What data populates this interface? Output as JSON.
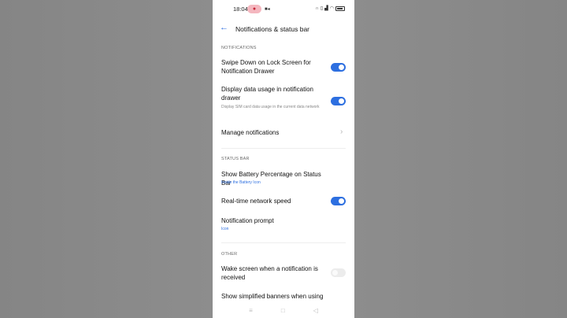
{
  "statusbar": {
    "time": "18:04",
    "icons": [
      "microphone-icon",
      "video-icon",
      "headphones-icon",
      "vibrate-icon",
      "signal-icon",
      "wifi-icon",
      "battery-icon"
    ]
  },
  "header": {
    "title": "Notifications & status bar"
  },
  "sections": {
    "notifications": "NOTIFICATIONS",
    "status_bar": "STATUS BAR",
    "other": "OTHER"
  },
  "rows": {
    "swipe_down": {
      "title": "Swipe Down on Lock Screen for Notification Drawer",
      "on": true
    },
    "data_usage": {
      "title": "Display data usage in notification drawer",
      "subtitle": "Display SIM card data usage in the current data network",
      "on": true
    },
    "manage": {
      "title": "Manage notifications"
    },
    "battery_pct": {
      "title": "Show Battery Percentage on Status Bar",
      "value": "Inside the Battery Icon"
    },
    "network_speed": {
      "title": "Real-time network speed",
      "on": true
    },
    "prompt": {
      "title": "Notification prompt",
      "value": "Icon"
    },
    "wake_screen": {
      "title": "Wake screen when a notification is received",
      "on": false
    },
    "simplified": {
      "title": "Show simplified banners when using"
    }
  },
  "colors": {
    "accent": "#2d6fe0",
    "toggle_off": "#ececec",
    "background": "#ffffff"
  }
}
